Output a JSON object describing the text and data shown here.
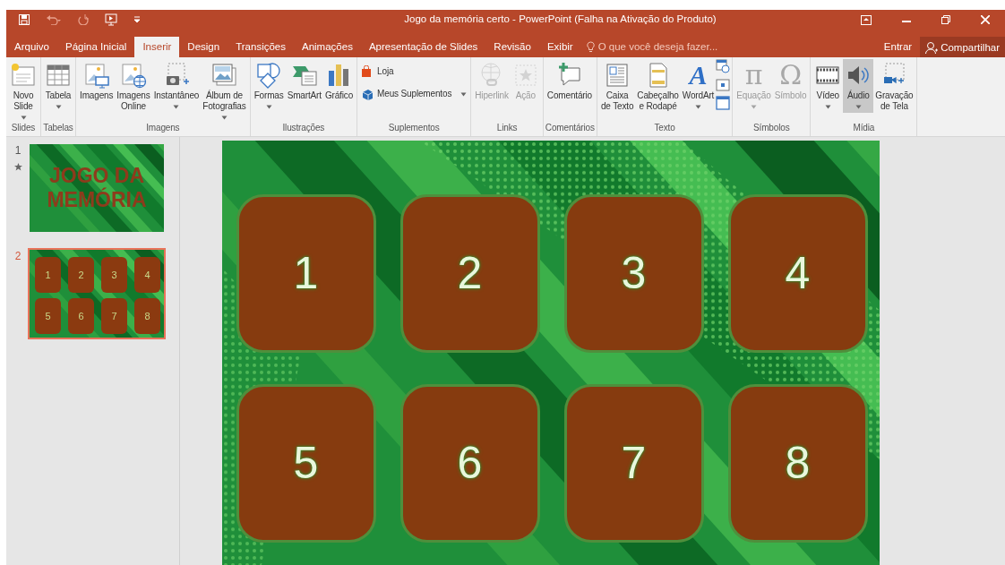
{
  "window": {
    "title": "Jogo da memória certo - PowerPoint (Falha na Ativação do Produto)"
  },
  "tabs": [
    {
      "label": "Arquivo",
      "selected": false
    },
    {
      "label": "Página Inicial",
      "selected": false
    },
    {
      "label": "Inserir",
      "selected": true
    },
    {
      "label": "Design",
      "selected": false
    },
    {
      "label": "Transições",
      "selected": false
    },
    {
      "label": "Animações",
      "selected": false
    },
    {
      "label": "Apresentação de Slides",
      "selected": false
    },
    {
      "label": "Revisão",
      "selected": false
    },
    {
      "label": "Exibir",
      "selected": false
    }
  ],
  "tell_me": {
    "placeholder": "O que você deseja fazer..."
  },
  "account": {
    "sign_in": "Entrar",
    "share": "Compartilhar"
  },
  "ribbon": {
    "groups": [
      {
        "label": "Slides",
        "buttons": [
          {
            "kind": "large",
            "label": "Novo\nSlide",
            "dropdown": true,
            "disabled": false,
            "hovered": false
          }
        ]
      },
      {
        "label": "Tabelas",
        "buttons": [
          {
            "kind": "large",
            "label": "Tabela",
            "dropdown": true,
            "disabled": false,
            "hovered": false
          }
        ]
      },
      {
        "label": "Imagens",
        "buttons": [
          {
            "kind": "large",
            "label": "Imagens",
            "dropdown": false,
            "disabled": false,
            "hovered": false
          },
          {
            "kind": "large",
            "label": "Imagens\nOnline",
            "dropdown": false,
            "disabled": false,
            "hovered": false
          },
          {
            "kind": "large",
            "label": "Instantâneo",
            "dropdown": true,
            "disabled": false,
            "hovered": false
          },
          {
            "kind": "large",
            "label": "Álbum de\nFotografias",
            "dropdown": true,
            "disabled": false,
            "hovered": false
          }
        ]
      },
      {
        "label": "Ilustrações",
        "buttons": [
          {
            "kind": "large",
            "label": "Formas",
            "dropdown": true,
            "disabled": false,
            "hovered": false
          },
          {
            "kind": "large",
            "label": "SmartArt",
            "dropdown": false,
            "disabled": false,
            "hovered": false
          },
          {
            "kind": "large",
            "label": "Gráfico",
            "dropdown": false,
            "disabled": false,
            "hovered": false
          }
        ]
      },
      {
        "label": "Suplementos",
        "buttons": [
          {
            "kind": "small",
            "label": "Loja",
            "dropdown": false,
            "disabled": false,
            "hovered": false
          },
          {
            "kind": "small",
            "label": "Meus Suplementos",
            "dropdown": true,
            "disabled": false,
            "hovered": false
          }
        ]
      },
      {
        "label": "Links",
        "buttons": [
          {
            "kind": "large",
            "label": "Hiperlink",
            "dropdown": false,
            "disabled": true,
            "hovered": false
          },
          {
            "kind": "large",
            "label": "Ação",
            "dropdown": false,
            "disabled": true,
            "hovered": false
          }
        ]
      },
      {
        "label": "Comentários",
        "buttons": [
          {
            "kind": "large",
            "label": "Comentário",
            "dropdown": false,
            "disabled": false,
            "hovered": false
          }
        ]
      },
      {
        "label": "Texto",
        "buttons": [
          {
            "kind": "large",
            "label": "Caixa\nde Texto",
            "dropdown": false,
            "disabled": false,
            "hovered": false
          },
          {
            "kind": "large",
            "label": "Cabeçalho\ne Rodapé",
            "dropdown": false,
            "disabled": false,
            "hovered": false
          },
          {
            "kind": "large",
            "label": "WordArt",
            "glyph": "A",
            "dropdown": true,
            "disabled": false,
            "hovered": false
          },
          {
            "kind": "icons"
          }
        ]
      },
      {
        "label": "Símbolos",
        "buttons": [
          {
            "kind": "large",
            "label": "Equação",
            "glyph": "π",
            "dropdown": true,
            "disabled": true,
            "hovered": false
          },
          {
            "kind": "large",
            "label": "Símbolo",
            "glyph": "Ω",
            "dropdown": false,
            "disabled": true,
            "hovered": false
          }
        ]
      },
      {
        "label": "Mídia",
        "buttons": [
          {
            "kind": "large",
            "label": "Vídeo",
            "dropdown": true,
            "disabled": false,
            "hovered": false
          },
          {
            "kind": "large",
            "label": "Áudio",
            "dropdown": true,
            "disabled": false,
            "hovered": true
          },
          {
            "kind": "large",
            "label": "Gravação\nde Tela",
            "dropdown": false,
            "disabled": false,
            "hovered": false
          }
        ]
      }
    ]
  },
  "thumbnails": [
    {
      "number": "1",
      "kind": "title",
      "animated": true,
      "selected": false,
      "title": "JOGO DA MEMÓRIA"
    },
    {
      "number": "2",
      "kind": "cards",
      "animated": false,
      "selected": true,
      "cards": [
        "1",
        "2",
        "3",
        "4",
        "5",
        "6",
        "7",
        "8"
      ]
    }
  ],
  "slide": {
    "cards": [
      "1",
      "2",
      "3",
      "4",
      "5",
      "6",
      "7",
      "8"
    ]
  }
}
